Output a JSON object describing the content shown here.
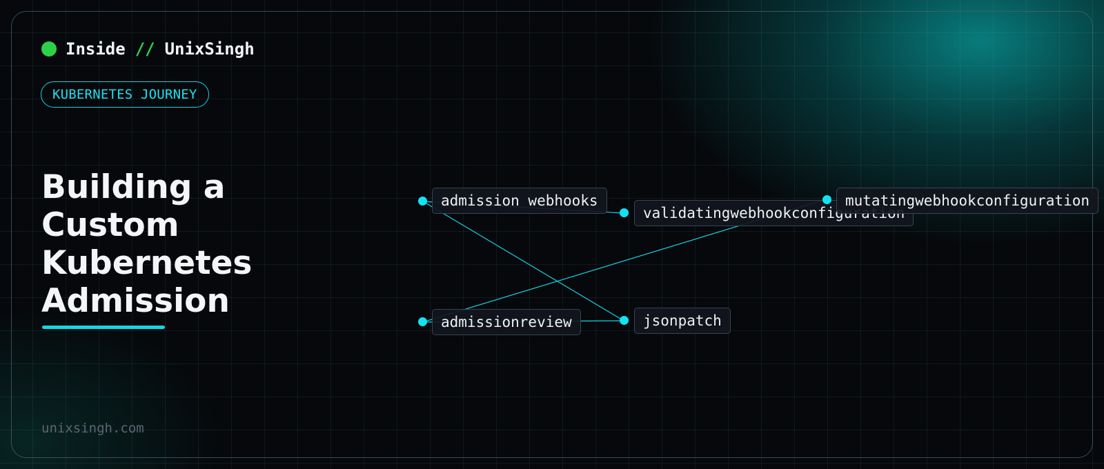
{
  "brand": {
    "name_left": "Inside",
    "separator": "//",
    "name_right": "UnixSingh",
    "status_color": "#2ed04a"
  },
  "tag": {
    "label": "KUBERNETES JOURNEY"
  },
  "title": {
    "text": "Building a Custom Kubernetes Admission"
  },
  "footer": {
    "domain": "unixsingh.com"
  },
  "diagram": {
    "accent_color": "#12e2f2",
    "nodes": [
      {
        "id": "admission-webhooks",
        "label": "admission webhooks"
      },
      {
        "id": "validatingwebhookconfiguration",
        "label": "validatingwebhookconfiguration"
      },
      {
        "id": "mutatingwebhookconfiguration",
        "label": "mutatingwebhookconfiguration"
      },
      {
        "id": "admissionreview",
        "label": "admissionreview"
      },
      {
        "id": "jsonpatch",
        "label": "jsonpatch"
      }
    ],
    "edges": [
      {
        "from": "admission-webhooks",
        "to": "validatingwebhookconfiguration"
      },
      {
        "from": "admission-webhooks",
        "to": "jsonpatch"
      },
      {
        "from": "admissionreview",
        "to": "mutatingwebhookconfiguration"
      },
      {
        "from": "admissionreview",
        "to": "jsonpatch"
      }
    ]
  }
}
